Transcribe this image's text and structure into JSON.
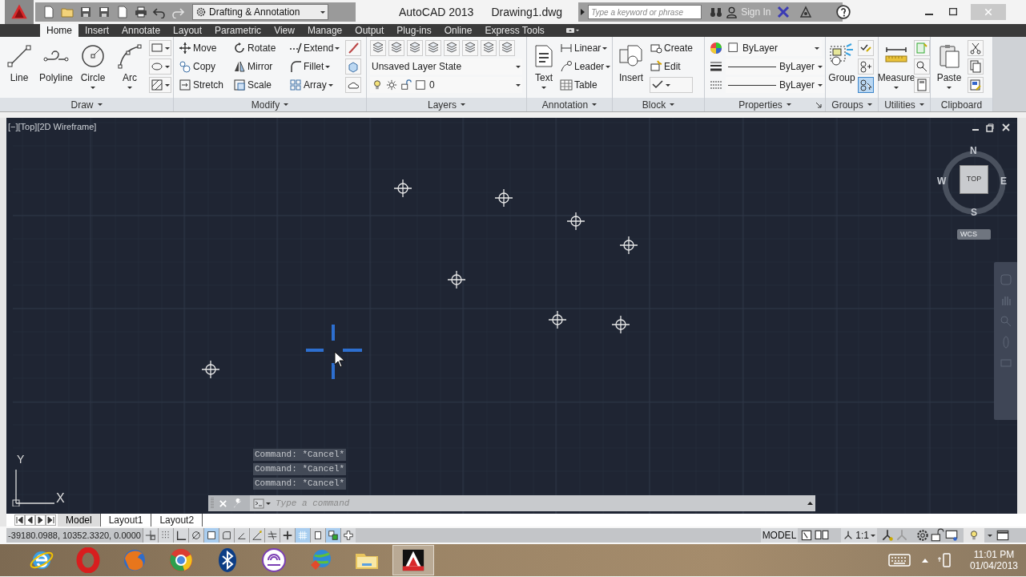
{
  "title_bar": {
    "workspace": "Drafting & Annotation",
    "app_title": "AutoCAD 2013",
    "file_name": "Drawing1.dwg",
    "search_placeholder": "Type a keyword or phrase",
    "sign_in": "Sign In"
  },
  "ribbon_tabs": [
    {
      "label": "Home",
      "selected": true
    },
    {
      "label": "Insert",
      "selected": false
    },
    {
      "label": "Annotate",
      "selected": false
    },
    {
      "label": "Layout",
      "selected": false
    },
    {
      "label": "Parametric",
      "selected": false
    },
    {
      "label": "View",
      "selected": false
    },
    {
      "label": "Manage",
      "selected": false
    },
    {
      "label": "Output",
      "selected": false
    },
    {
      "label": "Plug-ins",
      "selected": false
    },
    {
      "label": "Online",
      "selected": false
    },
    {
      "label": "Express Tools",
      "selected": false
    }
  ],
  "panels": [
    {
      "kind": "draw",
      "title": "Draw",
      "large_tools": [
        "Line",
        "Polyline",
        "Circle",
        "Arc"
      ]
    },
    {
      "kind": "modify",
      "title": "Modify",
      "tools": [
        "Move",
        "Rotate",
        "Extend",
        "Copy",
        "Mirror",
        "Fillet",
        "Stretch",
        "Scale",
        "Array"
      ]
    },
    {
      "kind": "layers",
      "title": "Layers",
      "layer_state": "Unsaved Layer State",
      "current_layer": "0"
    },
    {
      "kind": "annotation",
      "title": "Annotation",
      "large_tools": [
        "Text"
      ],
      "tools": [
        "Linear",
        "Leader",
        "Table"
      ]
    },
    {
      "kind": "block",
      "title": "Block",
      "large_tools": [
        "Insert"
      ],
      "tools": [
        "Create",
        "Edit"
      ]
    },
    {
      "kind": "properties",
      "title": "Properties",
      "rows": [
        "ByLayer",
        "ByLayer",
        "ByLayer"
      ]
    },
    {
      "kind": "groups",
      "title": "Groups",
      "large_tools": [
        "Group"
      ]
    },
    {
      "kind": "utilities",
      "title": "Utilities",
      "large_tools": [
        "Measure"
      ]
    },
    {
      "kind": "clipboard",
      "title": "Clipboard",
      "large_tools": [
        "Paste"
      ]
    }
  ],
  "viewport": {
    "label": "[−][Top][2D Wireframe]",
    "viewcube": {
      "north": "N",
      "west": "W",
      "face": "TOP",
      "east": "E",
      "south": "S"
    },
    "ucs_menu": "WCS",
    "ucs_axes": {
      "y": "Y",
      "x": "X"
    },
    "command_history": [
      "Command: *Cancel*",
      "Command: *Cancel*",
      "Command: *Cancel*"
    ],
    "command_placeholder": "Type a command"
  },
  "layout_tabs": [
    {
      "label": "Model",
      "selected": true
    },
    {
      "label": "Layout1",
      "selected": false
    },
    {
      "label": "Layout2",
      "selected": false
    }
  ],
  "status_bar": {
    "coordinates": "-39180.0988, 10352.3320, 0.0000",
    "toggles": [
      {
        "on": false
      },
      {
        "on": false
      },
      {
        "on": false
      },
      {
        "on": false
      },
      {
        "on": true
      },
      {
        "on": false
      },
      {
        "on": false
      },
      {
        "on": false
      },
      {
        "on": false
      },
      {
        "on": false
      },
      {
        "on": true
      },
      {
        "on": false
      },
      {
        "on": true
      },
      {
        "on": false
      }
    ],
    "model": "MODEL",
    "annotation_scale": "1:1"
  },
  "taskbar": {
    "apps": [
      {
        "kind": "e-globe",
        "selected": false
      },
      {
        "kind": "red-ring",
        "selected": false
      },
      {
        "kind": "fox-globe",
        "selected": false
      },
      {
        "kind": "wheel",
        "selected": false
      },
      {
        "kind": "bluetooth",
        "selected": false
      },
      {
        "kind": "swirl",
        "selected": false
      },
      {
        "kind": "download-globe",
        "selected": false
      },
      {
        "kind": "folder",
        "selected": false
      },
      {
        "kind": "cad",
        "selected": true
      }
    ],
    "clock_time": "11:01 PM",
    "clock_date": "01/04/2013"
  }
}
